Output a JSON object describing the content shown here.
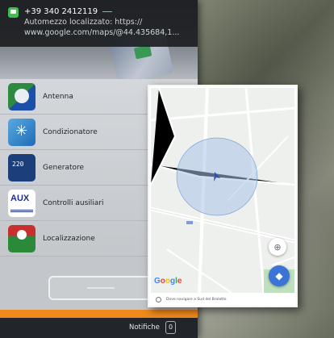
{
  "notification": {
    "sender": "+39 340 2412119",
    "line1": "Automezzo localizzato: https://",
    "line2": "www.google.com/maps/@44.435684,1..."
  },
  "menu": {
    "items": [
      {
        "label": "Antenna",
        "icon": "antenna-icon"
      },
      {
        "label": "Condizionatore",
        "icon": "air-conditioner-icon"
      },
      {
        "label": "Generatore",
        "icon": "generator-icon",
        "icon_text": "220"
      },
      {
        "label": "Controlli ausiliari",
        "icon": "aux-controls-icon",
        "icon_text": "AUX"
      },
      {
        "label": "Localizzazione",
        "icon": "location-icon"
      }
    ]
  },
  "footer": {
    "notifications_label": "Notifiche",
    "notifications_count": "0"
  },
  "map": {
    "logo": [
      "G",
      "o",
      "o",
      "g",
      "l",
      "e"
    ],
    "bottom_text": "Dove navigare a Sud del Broletto"
  },
  "colors": {
    "accent_orange": "#f08a1c",
    "map_blue": "#3b73d6",
    "notification_green": "#3fbf4f"
  }
}
